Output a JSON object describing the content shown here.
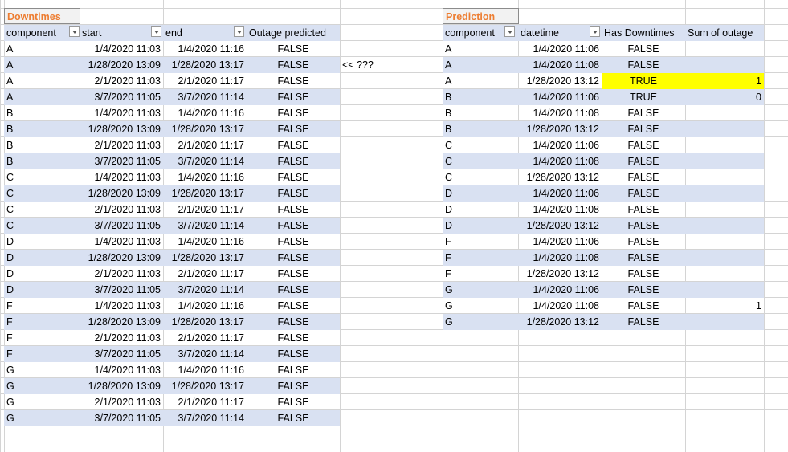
{
  "downtimes": {
    "title": "Downtimes",
    "headers": [
      "component",
      "start",
      "end",
      "Outage predicted"
    ],
    "rows": [
      [
        "A",
        "1/4/2020 11:03",
        "1/4/2020 11:16",
        "FALSE"
      ],
      [
        "A",
        "1/28/2020 13:09",
        "1/28/2020 13:17",
        "FALSE"
      ],
      [
        "A",
        "2/1/2020 11:03",
        "2/1/2020 11:17",
        "FALSE"
      ],
      [
        "A",
        "3/7/2020 11:05",
        "3/7/2020 11:14",
        "FALSE"
      ],
      [
        "B",
        "1/4/2020 11:03",
        "1/4/2020 11:16",
        "FALSE"
      ],
      [
        "B",
        "1/28/2020 13:09",
        "1/28/2020 13:17",
        "FALSE"
      ],
      [
        "B",
        "2/1/2020 11:03",
        "2/1/2020 11:17",
        "FALSE"
      ],
      [
        "B",
        "3/7/2020 11:05",
        "3/7/2020 11:14",
        "FALSE"
      ],
      [
        "C",
        "1/4/2020 11:03",
        "1/4/2020 11:16",
        "FALSE"
      ],
      [
        "C",
        "1/28/2020 13:09",
        "1/28/2020 13:17",
        "FALSE"
      ],
      [
        "C",
        "2/1/2020 11:03",
        "2/1/2020 11:17",
        "FALSE"
      ],
      [
        "C",
        "3/7/2020 11:05",
        "3/7/2020 11:14",
        "FALSE"
      ],
      [
        "D",
        "1/4/2020 11:03",
        "1/4/2020 11:16",
        "FALSE"
      ],
      [
        "D",
        "1/28/2020 13:09",
        "1/28/2020 13:17",
        "FALSE"
      ],
      [
        "D",
        "2/1/2020 11:03",
        "2/1/2020 11:17",
        "FALSE"
      ],
      [
        "D",
        "3/7/2020 11:05",
        "3/7/2020 11:14",
        "FALSE"
      ],
      [
        "F",
        "1/4/2020 11:03",
        "1/4/2020 11:16",
        "FALSE"
      ],
      [
        "F",
        "1/28/2020 13:09",
        "1/28/2020 13:17",
        "FALSE"
      ],
      [
        "F",
        "2/1/2020 11:03",
        "2/1/2020 11:17",
        "FALSE"
      ],
      [
        "F",
        "3/7/2020 11:05",
        "3/7/2020 11:14",
        "FALSE"
      ],
      [
        "G",
        "1/4/2020 11:03",
        "1/4/2020 11:16",
        "FALSE"
      ],
      [
        "G",
        "1/28/2020 13:09",
        "1/28/2020 13:17",
        "FALSE"
      ],
      [
        "G",
        "2/1/2020 11:03",
        "2/1/2020 11:17",
        "FALSE"
      ],
      [
        "G",
        "3/7/2020 11:05",
        "3/7/2020 11:14",
        "FALSE"
      ]
    ]
  },
  "note": "<< ???",
  "prediction": {
    "title": "Prediction",
    "headers": [
      "component",
      "datetime",
      "Has Downtimes",
      "Sum of outage"
    ],
    "rows": [
      [
        "A",
        "1/4/2020 11:06",
        "FALSE",
        ""
      ],
      [
        "A",
        "1/4/2020 11:08",
        "FALSE",
        ""
      ],
      [
        "A",
        "1/28/2020 13:12",
        "TRUE",
        "1"
      ],
      [
        "B",
        "1/4/2020 11:06",
        "TRUE",
        "0"
      ],
      [
        "B",
        "1/4/2020 11:08",
        "FALSE",
        ""
      ],
      [
        "B",
        "1/28/2020 13:12",
        "FALSE",
        ""
      ],
      [
        "C",
        "1/4/2020 11:06",
        "FALSE",
        ""
      ],
      [
        "C",
        "1/4/2020 11:08",
        "FALSE",
        ""
      ],
      [
        "C",
        "1/28/2020 13:12",
        "FALSE",
        ""
      ],
      [
        "D",
        "1/4/2020 11:06",
        "FALSE",
        ""
      ],
      [
        "D",
        "1/4/2020 11:08",
        "FALSE",
        ""
      ],
      [
        "D",
        "1/28/2020 13:12",
        "FALSE",
        ""
      ],
      [
        "F",
        "1/4/2020 11:06",
        "FALSE",
        ""
      ],
      [
        "F",
        "1/4/2020 11:08",
        "FALSE",
        ""
      ],
      [
        "F",
        "1/28/2020 13:12",
        "FALSE",
        ""
      ],
      [
        "G",
        "1/4/2020 11:06",
        "FALSE",
        ""
      ],
      [
        "G",
        "1/4/2020 11:08",
        "FALSE",
        "1"
      ],
      [
        "G",
        "1/28/2020 13:12",
        "FALSE",
        ""
      ]
    ],
    "highlight_row": 2
  },
  "colors": {
    "band": "#d9e1f2",
    "title": "#ed7d31",
    "highlight": "#ffff00"
  }
}
